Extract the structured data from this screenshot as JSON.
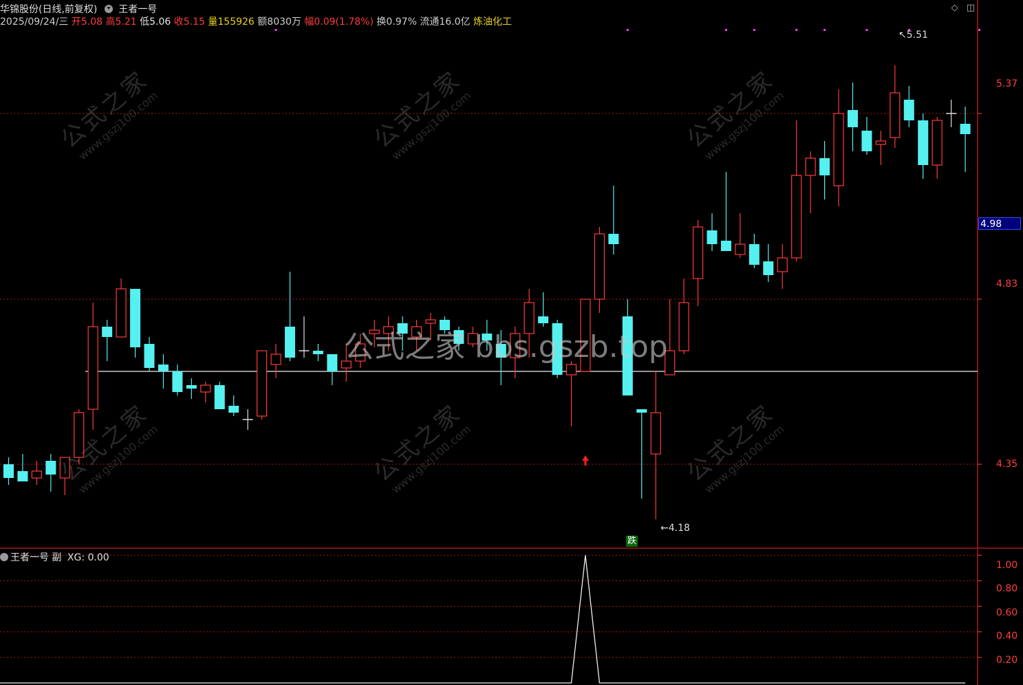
{
  "header": {
    "stock_title": "华锦股份(日线,前复权)",
    "indicator_name": "王者一号",
    "date": "2025/09/24/三",
    "open_label": "开",
    "open": "5.08",
    "high_label": "高",
    "high": "5.21",
    "low_label": "低",
    "low": "5.06",
    "close_label": "收",
    "close": "5.15",
    "volume_label": "量",
    "volume": "155926",
    "amount_label": "额",
    "amount": "8030万",
    "change_label": "幅",
    "change": "0.09(1.78%)",
    "turnover_label": "换",
    "turnover": "0.97%",
    "float_label": "流通",
    "float_value": "16.0亿",
    "sector": "炼油化工"
  },
  "toolbar_icons": [
    "diamond-icon",
    "window-icon"
  ],
  "watermark": {
    "center": "公式之家 bbs.gszb.top",
    "tile_big": "公式之家",
    "tile_small": "www.gszj100.com"
  },
  "price_axis": {
    "ticks": [
      "5.37",
      "4.83",
      "4.35"
    ],
    "current_price": "4.98"
  },
  "annotations": {
    "high_marker": "5.51",
    "low_marker": "4.18",
    "fall_badge": "跌"
  },
  "sub_panel": {
    "title": "王者一号 副",
    "xg_label": "XG:",
    "xg_value": "0.00",
    "ticks": [
      "1.00",
      "0.80",
      "0.60",
      "0.40",
      "0.20"
    ]
  },
  "colors": {
    "up": "#ff3b3b",
    "down": "#55f0f0",
    "doji": "#e0e0e0",
    "grid": "#aa1a1a",
    "marker": "#ff40ff",
    "background": "#000000"
  },
  "chart_data": {
    "type": "candlestick",
    "y_range": [
      4.12,
      5.62
    ],
    "support_line": 4.62,
    "candles": [
      {
        "o": 4.35,
        "h": 4.37,
        "l": 4.29,
        "c": 4.31
      },
      {
        "o": 4.33,
        "h": 4.38,
        "l": 4.3,
        "c": 4.3
      },
      {
        "o": 4.31,
        "h": 4.36,
        "l": 4.29,
        "c": 4.33
      },
      {
        "o": 4.36,
        "h": 4.38,
        "l": 4.27,
        "c": 4.32
      },
      {
        "o": 4.31,
        "h": 4.37,
        "l": 4.26,
        "c": 4.37
      },
      {
        "o": 4.37,
        "h": 4.51,
        "l": 4.35,
        "c": 4.5
      },
      {
        "o": 4.51,
        "h": 4.82,
        "l": 4.45,
        "c": 4.75
      },
      {
        "o": 4.75,
        "h": 4.77,
        "l": 4.65,
        "c": 4.72
      },
      {
        "o": 4.72,
        "h": 4.89,
        "l": 4.72,
        "c": 4.86
      },
      {
        "o": 4.86,
        "h": 4.86,
        "l": 4.66,
        "c": 4.69
      },
      {
        "o": 4.7,
        "h": 4.72,
        "l": 4.62,
        "c": 4.63
      },
      {
        "o": 4.64,
        "h": 4.67,
        "l": 4.57,
        "c": 4.62
      },
      {
        "o": 4.62,
        "h": 4.64,
        "l": 4.55,
        "c": 4.56
      },
      {
        "o": 4.58,
        "h": 4.6,
        "l": 4.54,
        "c": 4.57
      },
      {
        "o": 4.56,
        "h": 4.59,
        "l": 4.53,
        "c": 4.58
      },
      {
        "o": 4.58,
        "h": 4.59,
        "l": 4.51,
        "c": 4.51
      },
      {
        "o": 4.52,
        "h": 4.55,
        "l": 4.49,
        "c": 4.5
      },
      {
        "o": 4.48,
        "h": 4.51,
        "l": 4.45,
        "c": 4.48
      },
      {
        "o": 4.49,
        "h": 4.68,
        "l": 4.48,
        "c": 4.68
      },
      {
        "o": 4.64,
        "h": 4.7,
        "l": 4.6,
        "c": 4.67
      },
      {
        "o": 4.75,
        "h": 4.91,
        "l": 4.65,
        "c": 4.66
      },
      {
        "o": 4.68,
        "h": 4.78,
        "l": 4.66,
        "c": 4.68
      },
      {
        "o": 4.68,
        "h": 4.7,
        "l": 4.65,
        "c": 4.67
      },
      {
        "o": 4.67,
        "h": 4.67,
        "l": 4.58,
        "c": 4.62
      },
      {
        "o": 4.63,
        "h": 4.7,
        "l": 4.59,
        "c": 4.65
      },
      {
        "o": 4.65,
        "h": 4.73,
        "l": 4.63,
        "c": 4.7
      },
      {
        "o": 4.73,
        "h": 4.77,
        "l": 4.69,
        "c": 4.74
      },
      {
        "o": 4.73,
        "h": 4.78,
        "l": 4.68,
        "c": 4.75
      },
      {
        "o": 4.76,
        "h": 4.78,
        "l": 4.68,
        "c": 4.73
      },
      {
        "o": 4.72,
        "h": 4.77,
        "l": 4.68,
        "c": 4.75
      },
      {
        "o": 4.76,
        "h": 4.79,
        "l": 4.71,
        "c": 4.77
      },
      {
        "o": 4.77,
        "h": 4.78,
        "l": 4.73,
        "c": 4.74
      },
      {
        "o": 4.74,
        "h": 4.75,
        "l": 4.68,
        "c": 4.7
      },
      {
        "o": 4.7,
        "h": 4.75,
        "l": 4.69,
        "c": 4.73
      },
      {
        "o": 4.73,
        "h": 4.77,
        "l": 4.68,
        "c": 4.71
      },
      {
        "o": 4.7,
        "h": 4.74,
        "l": 4.58,
        "c": 4.66
      },
      {
        "o": 4.66,
        "h": 4.75,
        "l": 4.6,
        "c": 4.73
      },
      {
        "o": 4.73,
        "h": 4.86,
        "l": 4.66,
        "c": 4.82
      },
      {
        "o": 4.78,
        "h": 4.85,
        "l": 4.75,
        "c": 4.76
      },
      {
        "o": 4.76,
        "h": 4.77,
        "l": 4.6,
        "c": 4.61
      },
      {
        "o": 4.61,
        "h": 4.65,
        "l": 4.46,
        "c": 4.64
      },
      {
        "o": 4.62,
        "h": 4.83,
        "l": 4.62,
        "c": 4.83
      },
      {
        "o": 4.83,
        "h": 5.04,
        "l": 4.79,
        "c": 5.02
      },
      {
        "o": 5.02,
        "h": 5.16,
        "l": 4.96,
        "c": 4.99
      },
      {
        "o": 4.78,
        "h": 4.83,
        "l": 4.55,
        "c": 4.55
      },
      {
        "o": 4.51,
        "h": 4.51,
        "l": 4.25,
        "c": 4.5
      },
      {
        "o": 4.38,
        "h": 4.62,
        "l": 4.19,
        "c": 4.5
      },
      {
        "o": 4.61,
        "h": 4.83,
        "l": 4.61,
        "c": 4.68
      },
      {
        "o": 4.68,
        "h": 4.89,
        "l": 4.67,
        "c": 4.82
      },
      {
        "o": 4.89,
        "h": 5.06,
        "l": 4.81,
        "c": 5.04
      },
      {
        "o": 5.03,
        "h": 5.08,
        "l": 4.97,
        "c": 4.99
      },
      {
        "o": 5.0,
        "h": 5.2,
        "l": 4.98,
        "c": 4.97
      },
      {
        "o": 4.96,
        "h": 5.08,
        "l": 4.95,
        "c": 4.99
      },
      {
        "o": 4.99,
        "h": 5.02,
        "l": 4.92,
        "c": 4.93
      },
      {
        "o": 4.94,
        "h": 4.99,
        "l": 4.88,
        "c": 4.9
      },
      {
        "o": 4.91,
        "h": 4.99,
        "l": 4.86,
        "c": 4.95
      },
      {
        "o": 4.95,
        "h": 5.35,
        "l": 4.94,
        "c": 5.19
      },
      {
        "o": 5.19,
        "h": 5.26,
        "l": 5.08,
        "c": 5.24
      },
      {
        "o": 5.24,
        "h": 5.29,
        "l": 5.12,
        "c": 5.19
      },
      {
        "o": 5.16,
        "h": 5.44,
        "l": 5.1,
        "c": 5.37
      },
      {
        "o": 5.38,
        "h": 5.46,
        "l": 5.26,
        "c": 5.33
      },
      {
        "o": 5.32,
        "h": 5.36,
        "l": 5.25,
        "c": 5.26
      },
      {
        "o": 5.28,
        "h": 5.32,
        "l": 5.22,
        "c": 5.29
      },
      {
        "o": 5.3,
        "h": 5.51,
        "l": 5.27,
        "c": 5.43
      },
      {
        "o": 5.41,
        "h": 5.45,
        "l": 5.33,
        "c": 5.35
      },
      {
        "o": 5.35,
        "h": 5.37,
        "l": 5.18,
        "c": 5.22
      },
      {
        "o": 5.22,
        "h": 5.36,
        "l": 5.18,
        "c": 5.35
      },
      {
        "o": 5.37,
        "h": 5.41,
        "l": 5.33,
        "c": 5.37
      },
      {
        "o": 5.34,
        "h": 5.39,
        "l": 5.2,
        "c": 5.31
      }
    ],
    "xg_series": [
      0,
      0,
      0,
      0,
      0,
      0,
      0,
      0,
      0,
      0,
      0,
      0,
      0,
      0,
      0,
      0,
      0,
      0,
      0,
      0,
      0,
      0,
      0,
      0,
      0,
      0,
      0,
      0,
      0,
      0,
      0,
      0,
      0,
      0,
      0,
      0,
      0,
      0,
      0,
      0,
      0,
      1,
      0,
      0,
      0,
      0,
      0,
      0,
      0,
      0,
      0,
      0,
      0,
      0,
      0,
      0,
      0,
      0,
      0,
      0,
      0,
      0,
      0,
      0,
      0,
      0,
      0,
      0,
      0
    ],
    "xg_range": [
      0,
      1.05
    ],
    "top_markers": [
      19,
      44,
      51,
      53,
      56,
      58,
      61,
      64,
      69
    ]
  }
}
